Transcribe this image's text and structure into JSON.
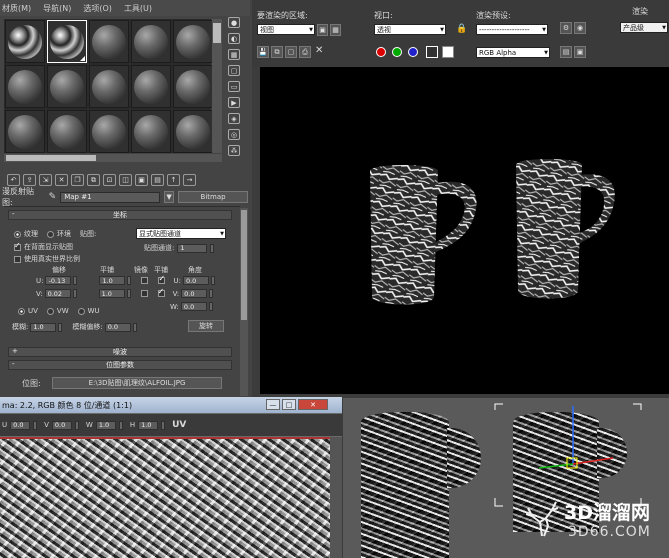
{
  "menu": [
    "材质(M)",
    "导航(N)",
    "选项(O)",
    "工具(U)"
  ],
  "toolbar_buttons": [
    "get-material",
    "put-to-scene",
    "assign",
    "reset",
    "copy",
    "unique",
    "library",
    "effects",
    "show-map",
    "show-end",
    "go-parent",
    "go-sibling"
  ],
  "map": {
    "label": "漫反射贴图:",
    "name": "Map #1",
    "type_button": "Bitmap"
  },
  "coordinates": {
    "rollout_title": "坐标",
    "radio_texture": "纹理",
    "radio_environ": "环境",
    "mapping_label": "贴图:",
    "mapping_value": "显式贴图通道",
    "show_map_on_back": "在背面显示贴图",
    "use_real_world": "使用真实世界比例",
    "map_channel_label": "贴图通道:",
    "map_channel_value": "1",
    "col_offset": "偏移",
    "col_tiling": "平铺",
    "col_mirror": "镜像",
    "col_tile": "平铺",
    "col_angle": "角度",
    "u_label": "U:",
    "v_label": "V:",
    "w_label": "W:",
    "u_offset": "-0.13",
    "v_offset": "0.02",
    "u_tiling": "1.0",
    "v_tiling": "1.0",
    "u_angle": "0.0",
    "v_angle": "0.0",
    "w_angle": "0.0",
    "uv": "UV",
    "vw": "VW",
    "wu": "WU",
    "blur_label": "模糊:",
    "blur_value": "1.0",
    "blur_offset_label": "模糊偏移:",
    "blur_offset_value": "0.0",
    "rotate_button": "旋转"
  },
  "noise_rollout": "噪波",
  "bitmap_rollout": "位图参数",
  "bitmap_label": "位图:",
  "bitmap_path": "E:\\3D贴图\\肌理纹\\ALFOIL.JPG",
  "render_panel": {
    "area_label": "要渲染的区域:",
    "area_value": "视图",
    "viewport_label": "视口:",
    "viewport_value": "透视",
    "preset_label": "渲染预设:",
    "preset_value": "--------------------",
    "render_button": "渲染",
    "product_value": "产品级",
    "channel_value": "RGB Alpha"
  },
  "frame_window": {
    "title": "ma: 2.2, RGB 颜色 8 位/通道 (1:1)",
    "min_button": "—",
    "max_button": "□",
    "close_button": "✕",
    "u_label": "U",
    "v_label": "V",
    "w_label": "W",
    "h_label": "H",
    "u_value": "0.0",
    "v_value": "0.0",
    "w_value": "1.0",
    "h_value": "1.0",
    "uv_label": "UV"
  },
  "watermark": {
    "main": "3D溜溜网",
    "sub": "3D66.COM"
  }
}
